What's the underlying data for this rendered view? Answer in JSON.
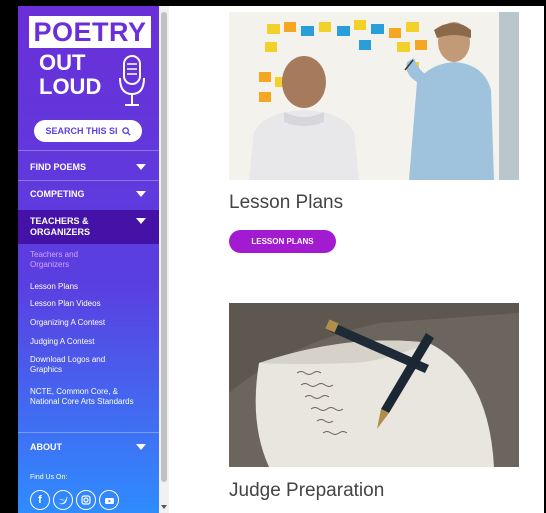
{
  "logo": {
    "line1": "POETRY",
    "line2": "OUT",
    "line3": "LOUD"
  },
  "search": {
    "label": "SEARCH THIS SI",
    "icon": "search-icon"
  },
  "nav": {
    "find_poems": "FIND POEMS",
    "competing": "COMPETING",
    "teachers": "TEACHERS & ORGANIZERS",
    "about": "ABOUT"
  },
  "subnav": [
    "Teachers and Organizers",
    "Lesson Plans",
    "Lesson Plan Videos",
    "Organizing A Contest",
    "Judging A Contest",
    "Download Logos and Graphics",
    "NCTE, Common Core, & National Core Arts Standards"
  ],
  "follow_label": "Find Us On:",
  "social_icons": [
    "facebook-icon",
    "twitter-icon",
    "instagram-icon",
    "youtube-icon"
  ],
  "main": {
    "card1": {
      "title": "Lesson Plans",
      "button": "LESSON PLANS"
    },
    "card2": {
      "title": "Judge Preparation"
    }
  },
  "colors": {
    "purple": "#6a2fd8",
    "deep_purple": "#4512a8",
    "blue": "#2f8cff",
    "button": "#a21bd1"
  }
}
